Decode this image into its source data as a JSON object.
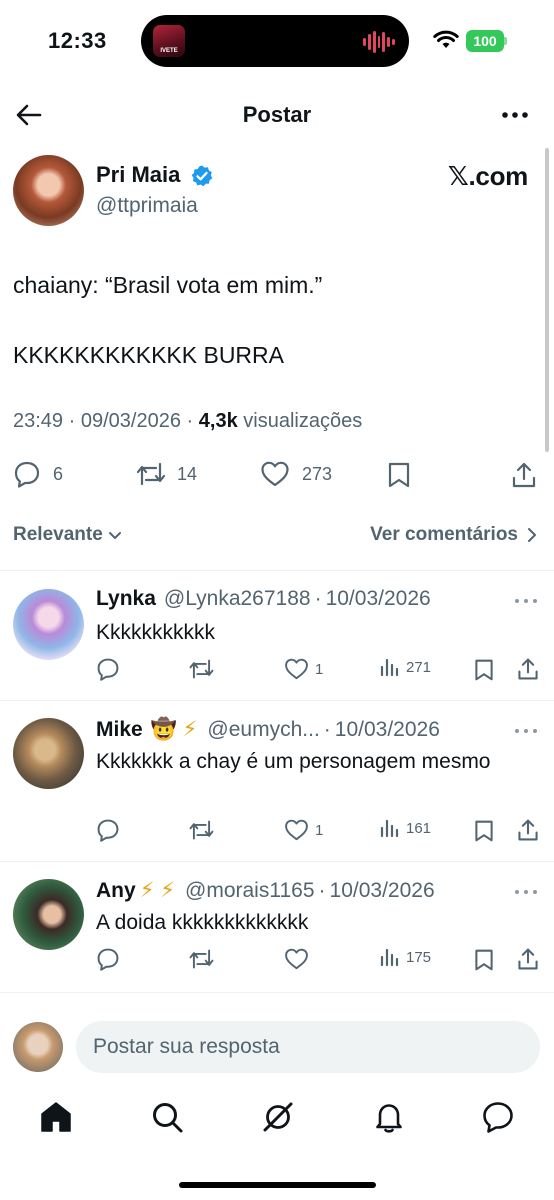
{
  "status_bar": {
    "time": "12:33",
    "battery": "100",
    "now_playing_art_text": "IVETE"
  },
  "header": {
    "title": "Postar",
    "back_icon": "arrow-left-icon",
    "more_icon": "more-horizontal-icon"
  },
  "post": {
    "author_name": "Pri Maia",
    "author_handle": "@ttprimaia",
    "verified": true,
    "watermark": "𝕏.com",
    "text_line_1": "chaiany: “Brasil vota em mim.”",
    "text_line_2": "KKKKKKKKKKKK BURRA",
    "time": "23:49",
    "date": "09/03/2026",
    "views_count": "4,3k",
    "views_label": "visualizações",
    "separator": "·",
    "replies": "6",
    "reposts": "14",
    "likes": "273"
  },
  "filter": {
    "sort_label": "Relevante",
    "view_comments_label": "Ver comentários"
  },
  "replies": [
    {
      "name": "Lynka",
      "emojis": "",
      "handle": "@Lynka267188",
      "date": "10/03/2026",
      "text": "Kkkkkkkkkkk",
      "replies": "",
      "reposts": "",
      "likes": "1",
      "views": "271"
    },
    {
      "name": "Mike",
      "emojis": "🤠 ⚡",
      "handle": "@eumych...",
      "date": "10/03/2026",
      "text": "Kkkkkkk a chay é um personagem mesmo",
      "replies": "",
      "reposts": "",
      "likes": "1",
      "views": "161"
    },
    {
      "name": "Any",
      "emojis": "⚡ ⚡",
      "handle": "@morais1165",
      "date": "10/03/2026",
      "text": "A doida kkkkkkkkkkkkk",
      "replies": "",
      "reposts": "",
      "likes": "",
      "views": "175"
    }
  ],
  "composer": {
    "placeholder": "Postar sua resposta"
  },
  "nav": [
    "home-icon",
    "search-icon",
    "grok-icon",
    "notifications-bell-icon",
    "messages-icon"
  ],
  "colors": {
    "text": "#0f1419",
    "secondary": "#536471",
    "verified": "#1d9bf0",
    "battery": "#34c759",
    "divider": "#eff3f4"
  }
}
